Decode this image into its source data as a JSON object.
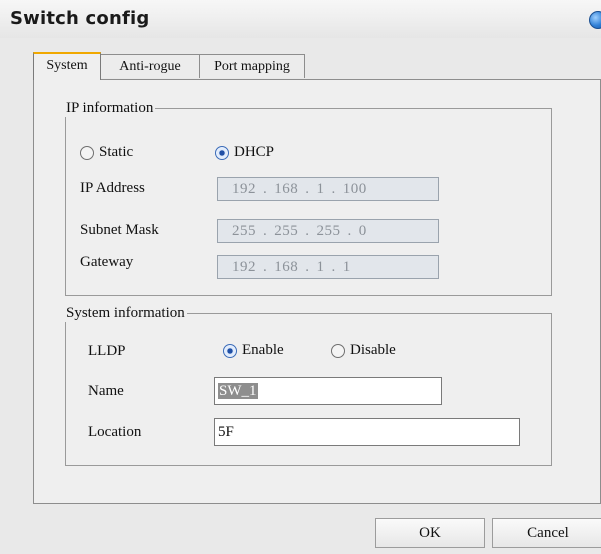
{
  "window": {
    "title": "Switch config",
    "icon": "help-icon"
  },
  "tabs": [
    {
      "label": "System",
      "active": true
    },
    {
      "label": "Anti-rogue",
      "active": false
    },
    {
      "label": "Port mapping",
      "active": false
    }
  ],
  "ip_info": {
    "legend": "IP information",
    "mode_options": {
      "static": "Static",
      "dhcp": "DHCP"
    },
    "selected_mode": "DHCP",
    "ip_address": {
      "label": "IP Address",
      "octets": [
        "192",
        "168",
        "1",
        "100"
      ]
    },
    "subnet_mask": {
      "label": "Subnet Mask",
      "octets": [
        "255",
        "255",
        "255",
        "0"
      ]
    },
    "gateway": {
      "label": "Gateway",
      "octets": [
        "192",
        "168",
        "1",
        "1"
      ]
    }
  },
  "system_info": {
    "legend": "System information",
    "lldp": {
      "label": "LLDP",
      "enable": "Enable",
      "disable": "Disable",
      "selected": "Enable"
    },
    "name": {
      "label": "Name",
      "value": "SW_1"
    },
    "location": {
      "label": "Location",
      "value": "5F"
    }
  },
  "buttons": {
    "ok": "OK",
    "cancel": "Cancel"
  },
  "colors": {
    "active_tab_accent": "#f0a800",
    "radio_checked": "#1f4fa6",
    "disabled_field": "#e2e6eb"
  }
}
